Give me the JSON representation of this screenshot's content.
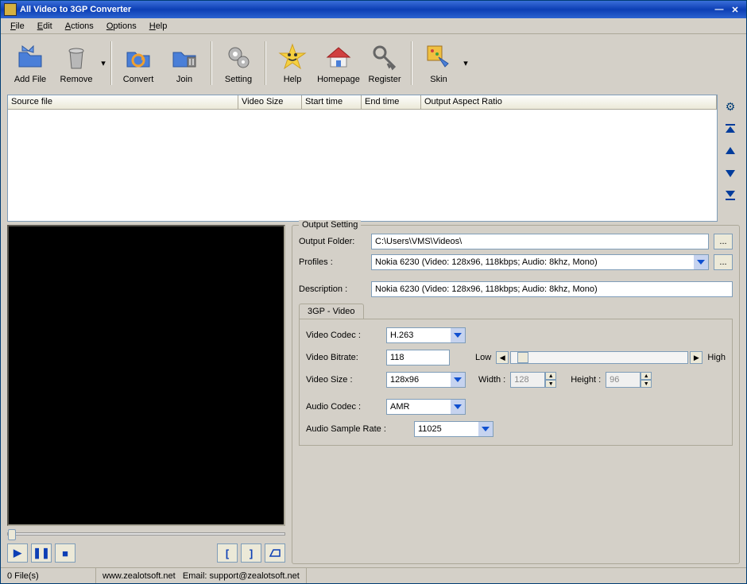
{
  "window": {
    "title": "All Video to 3GP Converter"
  },
  "menu": {
    "file": "File",
    "edit": "Edit",
    "actions": "Actions",
    "options": "Options",
    "help": "Help"
  },
  "toolbar": {
    "add_file": "Add File",
    "remove": "Remove",
    "convert": "Convert",
    "join": "Join",
    "setting": "Setting",
    "help": "Help",
    "homepage": "Homepage",
    "register": "Register",
    "skin": "Skin"
  },
  "list": {
    "cols": {
      "source": "Source file",
      "video_size": "Video Size",
      "start": "Start time",
      "end": "End time",
      "aspect": "Output Aspect Ratio"
    }
  },
  "output": {
    "legend": "Output Setting",
    "folder_label": "Output Folder:",
    "folder_value": "C:\\Users\\VMS\\Videos\\",
    "profiles_label": "Profiles :",
    "profiles_value": "Nokia 6230 (Video: 128x96, 118kbps; Audio: 8khz, Mono)",
    "desc_label": "Description :",
    "desc_value": "Nokia 6230 (Video: 128x96, 118kbps; Audio: 8khz, Mono)",
    "browse": "..."
  },
  "tab": {
    "title": "3GP - Video",
    "video_codec_label": "Video Codec :",
    "video_codec": "H.263",
    "video_bitrate_label": "Video Bitrate:",
    "video_bitrate": "118",
    "low": "Low",
    "high": "High",
    "video_size_label": "Video Size :",
    "video_size": "128x96",
    "width_label": "Width :",
    "width": "128",
    "height_label": "Height :",
    "height": "96",
    "audio_codec_label": "Audio Codec :",
    "audio_codec": "AMR",
    "audio_rate_label": "Audio Sample Rate :",
    "audio_rate": "11025"
  },
  "status": {
    "files": "0 File(s)",
    "url": "www.zealotsoft.net",
    "email": "Email: support@zealotsoft.net"
  }
}
